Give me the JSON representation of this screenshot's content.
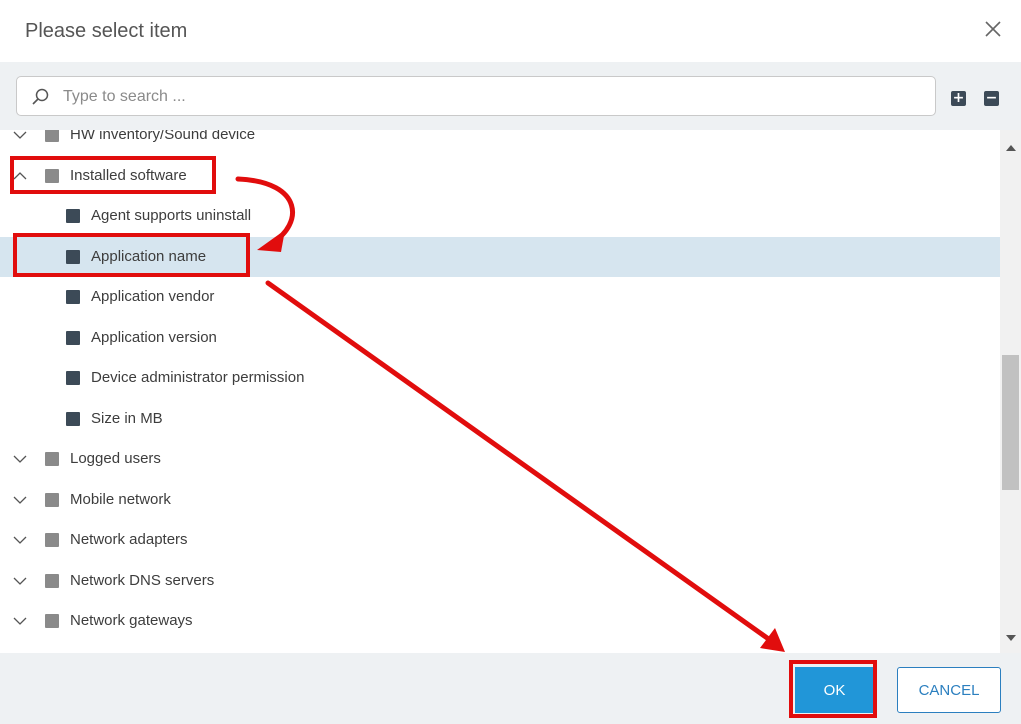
{
  "dialog": {
    "title": "Please select item",
    "close_icon": "close-icon"
  },
  "search": {
    "placeholder": "Type to search ...",
    "value": "",
    "icon": "search-icon"
  },
  "toolbar": {
    "expand_all_label": "+",
    "collapse_all_label": "−"
  },
  "tree": {
    "items": [
      {
        "label": "HW inventory/Sound device",
        "level": 0,
        "expanded": false,
        "selected": false,
        "partially_visible": true
      },
      {
        "label": "Installed software",
        "level": 0,
        "expanded": true,
        "selected": false
      },
      {
        "label": "Agent supports uninstall",
        "level": 1,
        "selected": false
      },
      {
        "label": "Application name",
        "level": 1,
        "selected": true
      },
      {
        "label": "Application vendor",
        "level": 1,
        "selected": false
      },
      {
        "label": "Application version",
        "level": 1,
        "selected": false
      },
      {
        "label": "Device administrator permission",
        "level": 1,
        "selected": false
      },
      {
        "label": "Size in MB",
        "level": 1,
        "selected": false
      },
      {
        "label": "Logged users",
        "level": 0,
        "expanded": false,
        "selected": false
      },
      {
        "label": "Mobile network",
        "level": 0,
        "expanded": false,
        "selected": false
      },
      {
        "label": "Network adapters",
        "level": 0,
        "expanded": false,
        "selected": false
      },
      {
        "label": "Network DNS servers",
        "level": 0,
        "expanded": false,
        "selected": false
      },
      {
        "label": "Network gateways",
        "level": 0,
        "expanded": false,
        "selected": false
      }
    ]
  },
  "footer": {
    "ok_label": "OK",
    "cancel_label": "CANCEL"
  },
  "colors": {
    "accent": "#2196d8",
    "selection": "#d6e5ef",
    "annotation": "#e10d0d",
    "group_box": "#8a8a8a",
    "leaf_box": "#3c4a57"
  }
}
